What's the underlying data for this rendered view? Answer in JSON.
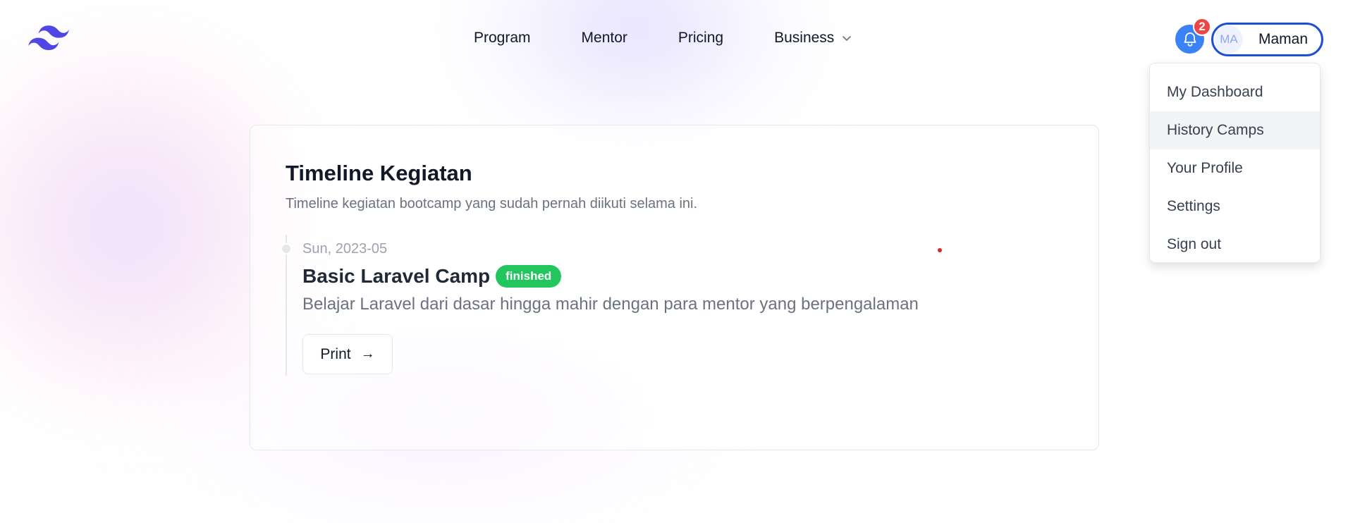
{
  "nav": {
    "items": [
      {
        "label": "Program"
      },
      {
        "label": "Mentor"
      },
      {
        "label": "Pricing"
      },
      {
        "label": "Business"
      }
    ]
  },
  "notifications": {
    "count": "2"
  },
  "user": {
    "initials": "MA",
    "name": "Maman"
  },
  "dropdown": {
    "items": [
      {
        "label": "My Dashboard"
      },
      {
        "label": "History Camps",
        "active": true
      },
      {
        "label": "Your Profile"
      },
      {
        "label": "Settings"
      },
      {
        "label": "Sign out"
      }
    ]
  },
  "page": {
    "title": "Timeline Kegiatan",
    "subtitle": "Timeline kegiatan bootcamp yang sudah pernah diikuti selama ini."
  },
  "timeline": [
    {
      "date": "Sun, 2023-05",
      "title": "Basic Laravel Camp",
      "status": "finished",
      "description": "Belajar Laravel dari dasar hingga mahir dengan para mentor yang berpengalaman",
      "button": "Print",
      "button_icon": "arrow-right-icon"
    }
  ],
  "colors": {
    "brand": "#4f46e5",
    "accent": "#3b82f6",
    "badge": "#ef4444",
    "status_finished": "#22c55e"
  }
}
